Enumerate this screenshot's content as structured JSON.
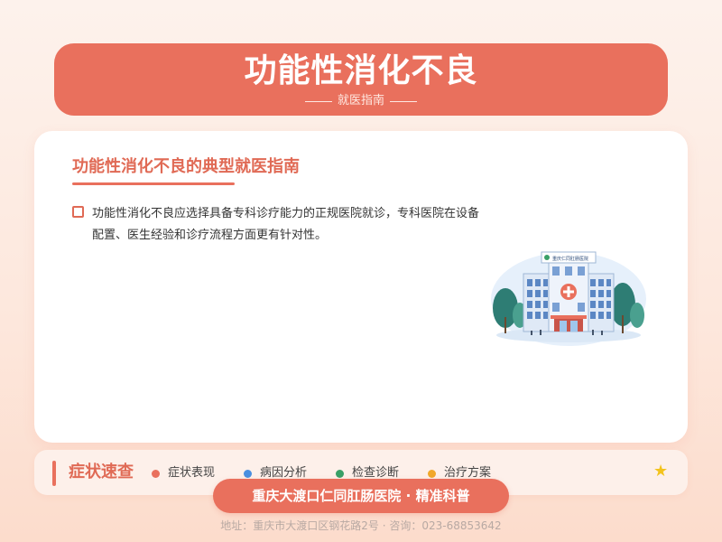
{
  "header": {
    "title": "功能性消化不良",
    "subtitle": "就医指南"
  },
  "card": {
    "title": "功能性消化不良的典型就医指南",
    "text": "功能性消化不良应选择具备专科诊疗能力的正规医院就诊，专科医院在设备配置、医生经验和诊疗流程方面更有针对性。",
    "hospital_sign": "重庆仁同肛肠医院"
  },
  "symptom_bar": {
    "title": "症状速查",
    "items": [
      {
        "label": "症状表现",
        "color": "#e9705d"
      },
      {
        "label": "病因分析",
        "color": "#4a8fe0"
      },
      {
        "label": "检查诊断",
        "color": "#3aa067"
      },
      {
        "label": "治疗方案",
        "color": "#f1a82a"
      }
    ]
  },
  "footer": {
    "banner": "重庆大渡口仁同肛肠医院 · 精准科普",
    "address": "地址：重庆市大渡口区钢花路2号 · 咨询：023-68853642"
  },
  "colors": {
    "accent": "#e9705d",
    "star": "#f3c31c"
  }
}
